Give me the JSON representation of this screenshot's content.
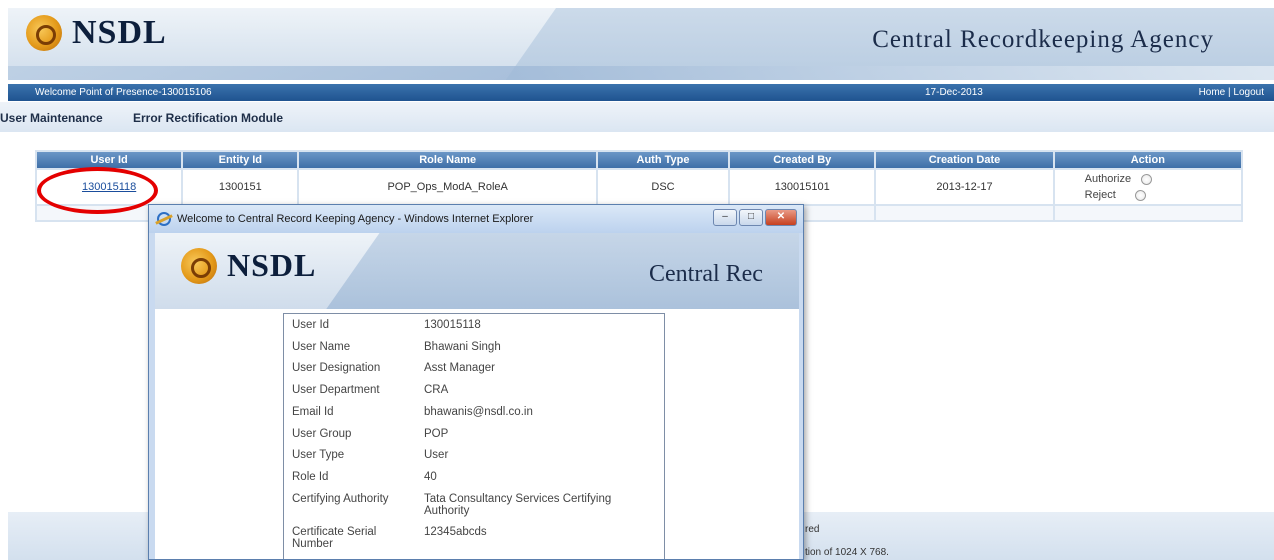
{
  "header": {
    "logo_text": "NSDL",
    "agency_title": "Central Recordkeeping Agency"
  },
  "welcome_bar": {
    "welcome_text": "Welcome Point of Presence-130015106",
    "date": "17-Dec-2013",
    "home_label": "Home",
    "separator": " | ",
    "logout_label": "Logout"
  },
  "menu": {
    "items": [
      {
        "label": "User Maintenance"
      },
      {
        "label": "Error Rectification Module"
      }
    ]
  },
  "table": {
    "headers": [
      "User Id",
      "Entity Id",
      "Role Name",
      "Auth Type",
      "Created By",
      "Creation Date",
      "Action"
    ],
    "rows": [
      {
        "user_id": "130015118",
        "entity_id": "1300151",
        "role_name": "POP_Ops_ModA_RoleA",
        "auth_type": "DSC",
        "created_by": "130015101",
        "creation_date": "2013-12-17",
        "authorize_label": "Authorize",
        "reject_label": "Reject"
      }
    ]
  },
  "footer": {
    "line1": "red",
    "line2": "tion of 1024 X 768."
  },
  "popup": {
    "window_title": "Welcome to Central Record Keeping Agency - Windows Internet Explorer",
    "logo_text": "NSDL",
    "agency_title": "Central Rec",
    "details": [
      {
        "label": "User Id",
        "value": "130015118"
      },
      {
        "label": "User Name",
        "value": "Bhawani Singh"
      },
      {
        "label": "User Designation",
        "value": "Asst Manager"
      },
      {
        "label": "User Department",
        "value": "CRA"
      },
      {
        "label": "Email Id",
        "value": "bhawanis@nsdl.co.in"
      },
      {
        "label": "User Group",
        "value": "POP"
      },
      {
        "label": "User Type",
        "value": "User"
      },
      {
        "label": "Role Id",
        "value": "40"
      },
      {
        "label": "Certifying Authority",
        "value": "Tata Consultancy Services Certifying Authority"
      },
      {
        "label": "Certificate Serial Number",
        "value": "12345abcds"
      }
    ]
  },
  "colors": {
    "accent_blue": "#1f5390",
    "header_row": "#3e6fa8",
    "highlight_oval": "#e40000"
  }
}
